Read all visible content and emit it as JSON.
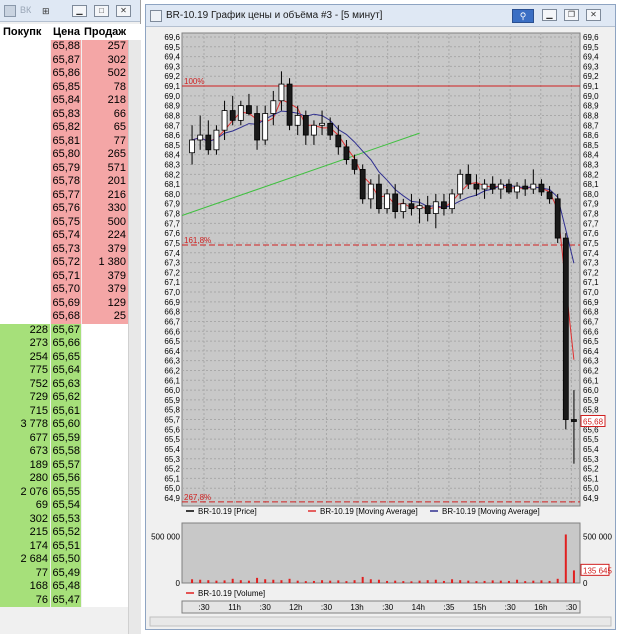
{
  "orderbook": {
    "title": "ВК",
    "headers": {
      "buy": "Покупк",
      "price": "Цена",
      "sell": "Продаж"
    },
    "asks": [
      [
        "65,88",
        "257"
      ],
      [
        "65,87",
        "302"
      ],
      [
        "65,86",
        "502"
      ],
      [
        "65,85",
        "78"
      ],
      [
        "65,84",
        "218"
      ],
      [
        "65,83",
        "66"
      ],
      [
        "65,82",
        "65"
      ],
      [
        "65,81",
        "77"
      ],
      [
        "65,80",
        "265"
      ],
      [
        "65,79",
        "571"
      ],
      [
        "65,78",
        "201"
      ],
      [
        "65,77",
        "216"
      ],
      [
        "65,76",
        "330"
      ],
      [
        "65,75",
        "500"
      ],
      [
        "65,74",
        "224"
      ],
      [
        "65,73",
        "379"
      ],
      [
        "65,72",
        "1 380"
      ],
      [
        "65,71",
        "379"
      ],
      [
        "65,70",
        "379"
      ],
      [
        "65,69",
        "129"
      ],
      [
        "65,68",
        "25"
      ]
    ],
    "bids": [
      [
        "228",
        "65,67"
      ],
      [
        "273",
        "65,66"
      ],
      [
        "254",
        "65,65"
      ],
      [
        "775",
        "65,64"
      ],
      [
        "752",
        "65,63"
      ],
      [
        "729",
        "65,62"
      ],
      [
        "715",
        "65,61"
      ],
      [
        "3 778",
        "65,60"
      ],
      [
        "677",
        "65,59"
      ],
      [
        "673",
        "65,58"
      ],
      [
        "189",
        "65,57"
      ],
      [
        "280",
        "65,56"
      ],
      [
        "2 076",
        "65,55"
      ],
      [
        "69",
        "65,54"
      ],
      [
        "302",
        "65,53"
      ],
      [
        "215",
        "65,52"
      ],
      [
        "174",
        "65,51"
      ],
      [
        "2 684",
        "65,50"
      ],
      [
        "77",
        "65,49"
      ],
      [
        "168",
        "65,48"
      ],
      [
        "76",
        "65,47"
      ]
    ]
  },
  "chart_window": {
    "title": "BR-10.19 График цены и объёма #3 - [5 минут]"
  },
  "chart_data": {
    "type": "candlestick",
    "instrument": "BR-10.19",
    "timeframe": "5 минут",
    "price_axis": {
      "ylim": [
        64.9,
        69.6
      ],
      "ticks": [
        "69,6",
        "69,5",
        "69,4",
        "69,3",
        "69,2",
        "69,1",
        "69,0",
        "68,9",
        "68,8",
        "68,7",
        "68,6",
        "68,5",
        "68,4",
        "68,3",
        "68,2",
        "68,1",
        "68,0",
        "67,9",
        "67,8",
        "67,7",
        "67,6",
        "67,5",
        "67,4",
        "67,3",
        "67,2",
        "67,1",
        "67,0",
        "66,9",
        "66,8",
        "66,7",
        "66,6",
        "66,5",
        "66,4",
        "66,3",
        "66,2",
        "66,1",
        "66,0",
        "65,9",
        "65,8",
        "65,7",
        "65,6",
        "65,5",
        "65,4",
        "65,3",
        "65,2",
        "65,1",
        "65,0",
        "64,9"
      ]
    },
    "time_axis_labels": [
      ":30",
      "11h",
      ":30",
      "12h",
      ":30",
      "13h",
      ":30",
      "14h",
      ":35",
      "15h",
      ":30",
      "16h",
      ":30"
    ],
    "fib_levels": [
      {
        "label": "100%",
        "value": 69.1,
        "style": "solid"
      },
      {
        "label": "161,8%",
        "value": 67.48,
        "style": "dashed"
      },
      {
        "label": "267,8%",
        "value": 64.86,
        "style": "dashed"
      }
    ],
    "last_price_label": "65,68",
    "last_price": 65.68,
    "trend_line": {
      "from": [
        0,
        67.78
      ],
      "to": [
        28,
        68.62
      ]
    },
    "legend": [
      {
        "name": "BR-10.19 [Price]",
        "color": "#000000"
      },
      {
        "name": "BR-10.19 [Moving Average]",
        "color": "#e03030"
      },
      {
        "name": "BR-10.19 [Moving Average]",
        "color": "#303090"
      }
    ],
    "volume": {
      "ticks": [
        "500 000",
        "0"
      ],
      "ylim": [
        0,
        600000
      ],
      "last_label": "135 645",
      "legend": "BR-10.19 [Volume]"
    },
    "candles": [
      [
        68.42,
        68.7,
        68.3,
        68.55
      ],
      [
        68.55,
        68.8,
        68.45,
        68.6
      ],
      [
        68.6,
        68.75,
        68.4,
        68.45
      ],
      [
        68.45,
        68.7,
        68.4,
        68.65
      ],
      [
        68.65,
        68.95,
        68.55,
        68.85
      ],
      [
        68.85,
        69.0,
        68.7,
        68.75
      ],
      [
        68.75,
        68.95,
        68.7,
        68.9
      ],
      [
        68.9,
        69.02,
        68.8,
        68.82
      ],
      [
        68.82,
        68.9,
        68.45,
        68.55
      ],
      [
        68.55,
        68.9,
        68.5,
        68.82
      ],
      [
        68.82,
        69.05,
        68.7,
        68.95
      ],
      [
        68.95,
        69.25,
        68.85,
        69.12
      ],
      [
        69.12,
        69.18,
        68.65,
        68.7
      ],
      [
        68.7,
        68.9,
        68.6,
        68.8
      ],
      [
        68.8,
        68.85,
        68.5,
        68.6
      ],
      [
        68.6,
        68.75,
        68.5,
        68.7
      ],
      [
        68.7,
        68.85,
        68.6,
        68.72
      ],
      [
        68.72,
        68.78,
        68.55,
        68.6
      ],
      [
        68.6,
        68.7,
        68.4,
        68.48
      ],
      [
        68.48,
        68.55,
        68.3,
        68.35
      ],
      [
        68.35,
        68.4,
        68.2,
        68.25
      ],
      [
        68.25,
        68.3,
        67.9,
        67.95
      ],
      [
        67.95,
        68.15,
        67.85,
        68.1
      ],
      [
        68.1,
        68.2,
        67.8,
        67.85
      ],
      [
        67.85,
        68.05,
        67.8,
        68.0
      ],
      [
        68.0,
        68.1,
        67.75,
        67.82
      ],
      [
        67.82,
        67.95,
        67.75,
        67.9
      ],
      [
        67.9,
        68.0,
        67.78,
        67.85
      ],
      [
        67.85,
        67.95,
        67.7,
        67.88
      ],
      [
        67.88,
        67.98,
        67.72,
        67.8
      ],
      [
        67.8,
        68.0,
        67.65,
        67.92
      ],
      [
        67.92,
        68.0,
        67.78,
        67.85
      ],
      [
        67.85,
        68.05,
        67.8,
        68.0
      ],
      [
        68.0,
        68.25,
        67.95,
        68.2
      ],
      [
        68.2,
        68.3,
        68.05,
        68.1
      ],
      [
        68.1,
        68.2,
        67.98,
        68.05
      ],
      [
        68.05,
        68.15,
        67.95,
        68.1
      ],
      [
        68.1,
        68.18,
        68.0,
        68.05
      ],
      [
        68.05,
        68.15,
        67.95,
        68.1
      ],
      [
        68.1,
        68.15,
        68.0,
        68.02
      ],
      [
        68.02,
        68.12,
        67.95,
        68.08
      ],
      [
        68.08,
        68.15,
        67.98,
        68.05
      ],
      [
        68.05,
        68.25,
        68.0,
        68.1
      ],
      [
        68.1,
        68.15,
        67.98,
        68.02
      ],
      [
        68.02,
        68.08,
        67.9,
        67.95
      ],
      [
        67.95,
        68.0,
        67.5,
        67.55
      ],
      [
        67.55,
        67.6,
        65.6,
        65.7
      ],
      [
        65.7,
        66.0,
        65.25,
        65.68
      ]
    ],
    "volumes": [
      40,
      35,
      30,
      25,
      28,
      45,
      30,
      25,
      55,
      40,
      35,
      30,
      45,
      25,
      20,
      22,
      30,
      25,
      28,
      20,
      30,
      65,
      40,
      35,
      22,
      25,
      20,
      18,
      25,
      30,
      35,
      22,
      40,
      30,
      25,
      20,
      22,
      28,
      25,
      22,
      35,
      20,
      25,
      28,
      22,
      45,
      520,
      135
    ]
  }
}
